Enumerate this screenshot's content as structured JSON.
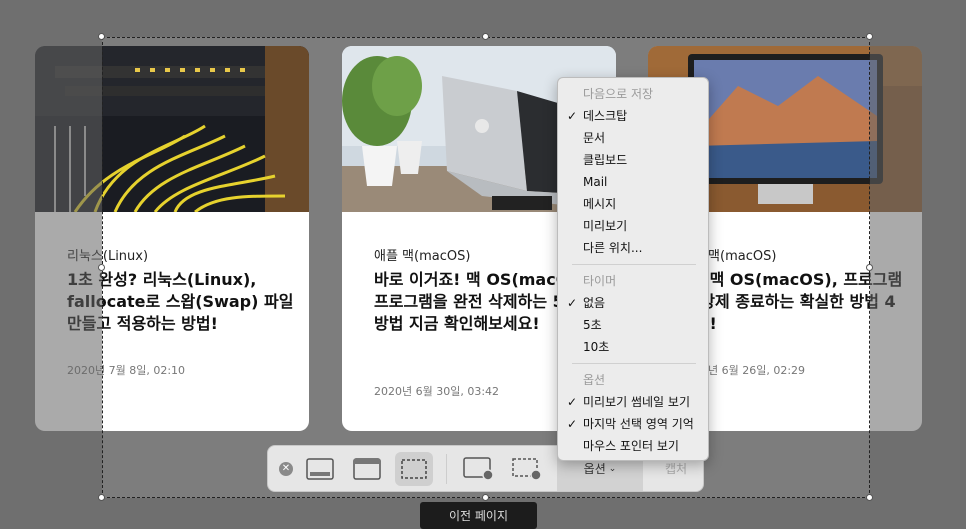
{
  "cards": [
    {
      "category": "리눅스(Linux)",
      "title": "1초 완성? 리눅스(Linux), fallocate로 스왑(Swap) 파일 만들고 적용하는 방법!",
      "date": "2020년 7월 8일, 02:10",
      "image": "server-cables-photo"
    },
    {
      "category": "애플 맥(macOS)",
      "title": "바로 이거죠! 맥 OS(macOS), 프로그램을 완전 삭제하는 5가지 방법 지금 확인해보세요!",
      "date": "2020년 6월 30일, 03:42",
      "image": "laptop-desk-photo"
    },
    {
      "category": "애플 맥(macOS)",
      "title": "컷? 맥 OS(macOS), 프로그램을 강제 종료하는 확실한 방법 4가지!",
      "date": "2020년 6월 26일, 02:29",
      "image": "imac-photo"
    }
  ],
  "menu": {
    "save_header": "다음으로 저장",
    "save_items": [
      {
        "label": "데스크탑",
        "checked": true
      },
      {
        "label": "문서",
        "checked": false
      },
      {
        "label": "클립보드",
        "checked": false
      },
      {
        "label": "Mail",
        "checked": false
      },
      {
        "label": "메시지",
        "checked": false
      },
      {
        "label": "미리보기",
        "checked": false
      },
      {
        "label": "다른 위치...",
        "checked": false
      }
    ],
    "timer_header": "타이머",
    "timer_items": [
      {
        "label": "없음",
        "checked": true
      },
      {
        "label": "5초",
        "checked": false
      },
      {
        "label": "10초",
        "checked": false
      }
    ],
    "options_header": "옵션",
    "option_items": [
      {
        "label": "미리보기 썸네일 보기",
        "checked": true
      },
      {
        "label": "마지막 선택 영역 기억",
        "checked": true
      },
      {
        "label": "마우스 포인터 보기",
        "checked": false
      }
    ]
  },
  "toolbar": {
    "options_label": "옵션",
    "capture_label": "캡처",
    "icons": [
      "close-icon",
      "capture-entire-screen-icon",
      "capture-window-icon",
      "capture-selection-icon",
      "record-screen-icon",
      "record-selection-icon"
    ],
    "active": "capture-selection-icon"
  },
  "bottom_button": "이전 페이지",
  "check_mark": "✓"
}
